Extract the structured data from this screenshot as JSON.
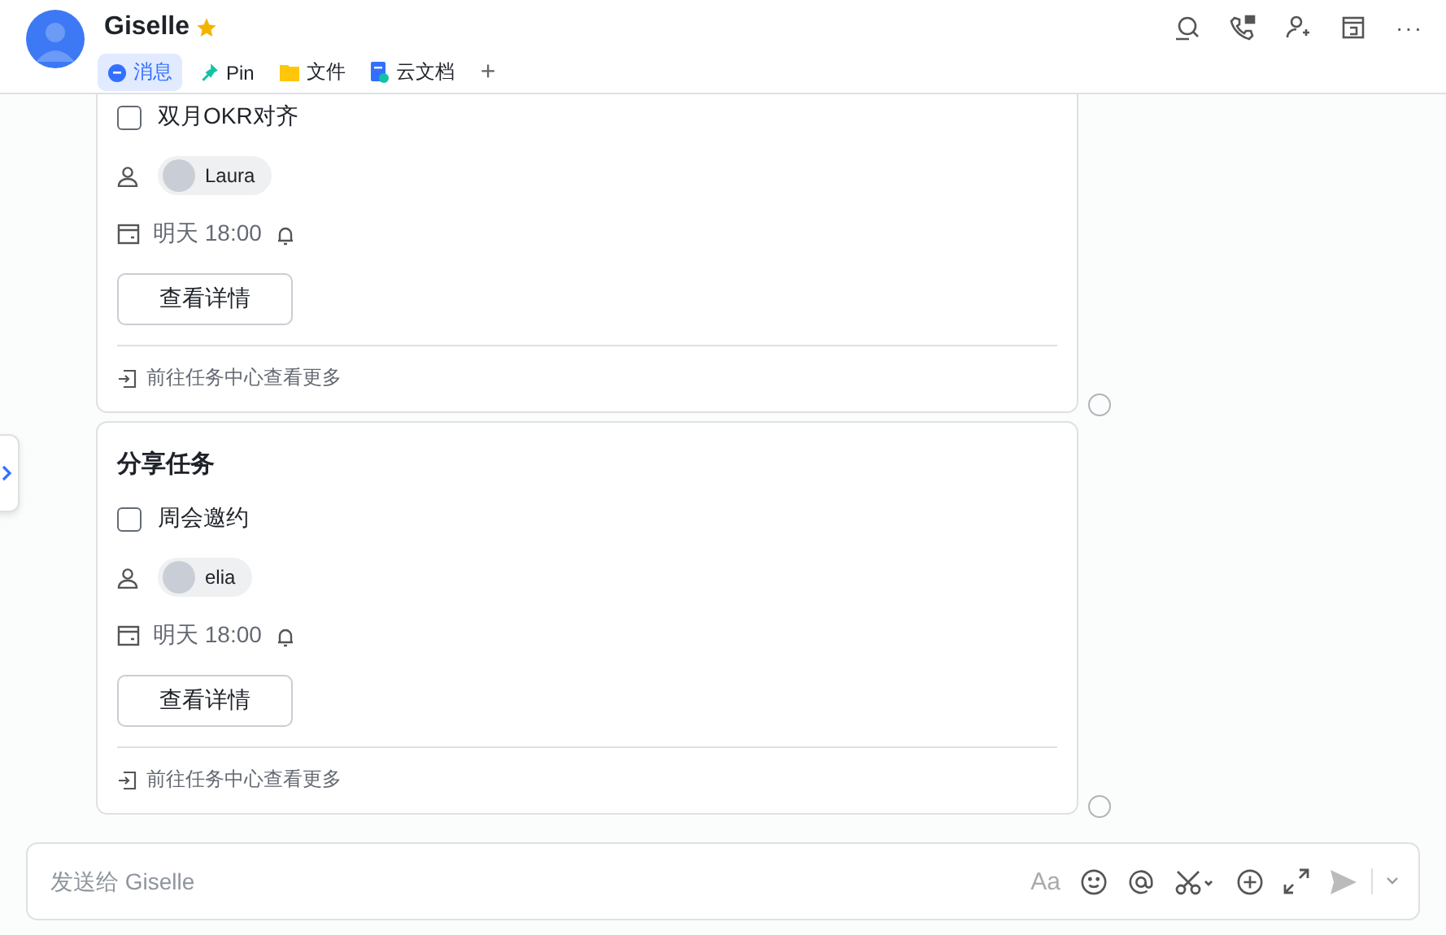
{
  "header": {
    "name": "Giselle",
    "starred": true,
    "tabs": [
      {
        "label": "消息",
        "kind": "chat",
        "selected": true
      },
      {
        "label": "Pin",
        "kind": "pin",
        "selected": false
      },
      {
        "label": "文件",
        "kind": "folder",
        "selected": false
      },
      {
        "label": "云文档",
        "kind": "doc",
        "selected": false
      }
    ],
    "add_tab": "+",
    "more": "···"
  },
  "cards": [
    {
      "task": "双月OKR对齐",
      "checked": false,
      "selected": false,
      "assignee": "Laura",
      "due": "明天 18:00",
      "button": "查看详情",
      "footer_link": "前往任务中心查看更多"
    },
    {
      "title": "分享任务",
      "task": "周会邀约",
      "checked": false,
      "selected": false,
      "assignee": "elia",
      "due": "明天 18:00",
      "button": "查看详情",
      "footer_link": "前往任务中心查看更多"
    }
  ],
  "composer": {
    "placeholder": "发送给 Giselle",
    "format_label": "Aa"
  }
}
